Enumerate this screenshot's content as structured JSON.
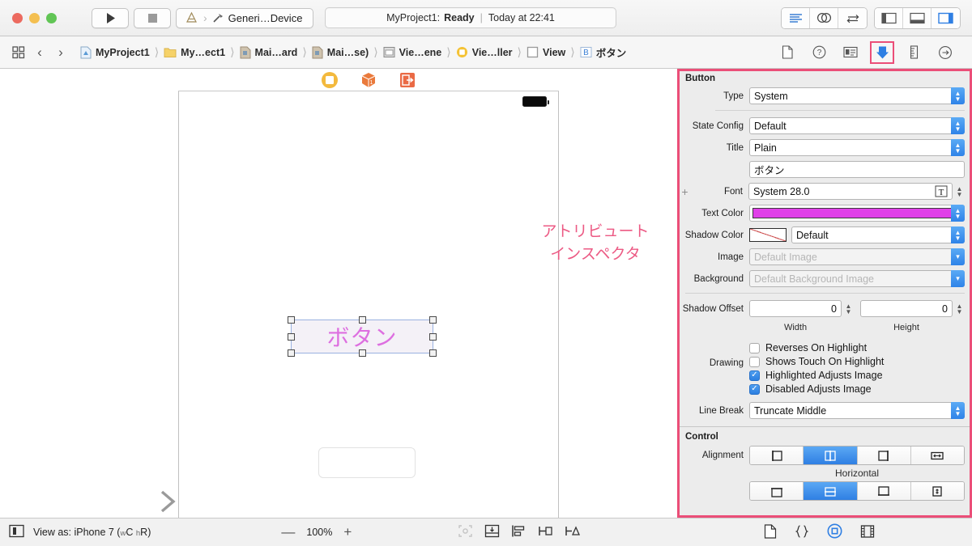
{
  "window": {
    "traffic_lights": [
      "close",
      "minimize",
      "zoom"
    ]
  },
  "toolbar": {
    "run_label": "Run",
    "stop_label": "Stop",
    "scheme_label": "Generi…Device",
    "status_project": "MyProject1:",
    "status_state": "Ready",
    "status_separator": "|",
    "status_time": "Today at 22:41",
    "editor_segments": [
      "standard-editor",
      "assistant-editor",
      "version-editor"
    ],
    "view_segments": [
      "navigator-toggle",
      "debug-area-toggle",
      "utilities-toggle"
    ]
  },
  "jumpbar": {
    "back_label": "‹",
    "forward_label": "›",
    "crumbs": [
      {
        "icon": "project-icon",
        "label": "MyProject1"
      },
      {
        "icon": "folder-icon",
        "label": "My…ect1"
      },
      {
        "icon": "storyboard-icon",
        "label": "Mai…ard"
      },
      {
        "icon": "storyboard-icon",
        "label": "Mai…se)"
      },
      {
        "icon": "scene-icon",
        "label": "Vie…ene"
      },
      {
        "icon": "viewcontroller-icon",
        "label": "Vie…ller"
      },
      {
        "icon": "view-icon",
        "label": "View"
      },
      {
        "icon": "button-icon",
        "label": "ボタン"
      }
    ],
    "inspector_tabs": [
      {
        "name": "file-inspector",
        "selected": false
      },
      {
        "name": "quick-help-inspector",
        "selected": false
      },
      {
        "name": "identity-inspector",
        "selected": false
      },
      {
        "name": "attributes-inspector",
        "selected": true
      },
      {
        "name": "size-inspector",
        "selected": false
      },
      {
        "name": "connections-inspector",
        "selected": false
      }
    ]
  },
  "canvas": {
    "scene_icons": [
      "view-controller-icon",
      "first-responder-icon",
      "exit-icon"
    ],
    "button": {
      "title": "ボタン",
      "selected": true
    },
    "textfield": {
      "placeholder": ""
    },
    "annotation_lines": [
      "アトリビュート",
      "インスペクタ"
    ],
    "annotation_color": "#ec5a84"
  },
  "inspector": {
    "sections": [
      {
        "title": "Button",
        "rows": [
          {
            "label": "Type",
            "value": "System",
            "control": "popup"
          },
          {
            "label": "State Config",
            "value": "Default",
            "control": "popup"
          },
          {
            "label": "Title",
            "value": "Plain",
            "control": "popup"
          },
          {
            "label": "",
            "value": "ボタン",
            "control": "text"
          },
          {
            "label": "Font",
            "value": "System 28.0",
            "control": "font"
          },
          {
            "label": "Text Color",
            "value": "#e040e8",
            "control": "color"
          },
          {
            "label": "Shadow Color",
            "value": "Default",
            "control": "color-popup"
          },
          {
            "label": "Image",
            "value": "Default Image",
            "control": "combo-placeholder"
          },
          {
            "label": "Background",
            "value": "Default Background Image",
            "control": "combo-placeholder"
          }
        ],
        "shadow_offset": {
          "label": "Shadow Offset",
          "width_value": "0",
          "height_value": "0",
          "width_caption": "Width",
          "height_caption": "Height"
        },
        "drawing": {
          "label": "Drawing",
          "items": [
            {
              "text": "Reverses On Highlight",
              "checked": false
            },
            {
              "text": "Shows Touch On Highlight",
              "checked": false
            },
            {
              "text": "Highlighted Adjusts Image",
              "checked": true
            },
            {
              "text": "Disabled Adjusts Image",
              "checked": true
            }
          ]
        },
        "line_break": {
          "label": "Line Break",
          "value": "Truncate Middle"
        }
      },
      {
        "title": "Control",
        "alignment": {
          "label": "Alignment",
          "caption": "Horizontal",
          "options": [
            "align-left",
            "align-center",
            "align-right",
            "align-fill"
          ],
          "selected_index": 1
        }
      }
    ]
  },
  "bottombar": {
    "view_as_label": "View as: iPhone 7 (",
    "view_as_size_w": "w",
    "view_as_size_c": "C",
    "view_as_size_h": "h",
    "view_as_size_r": "R)",
    "zoom_out": "—",
    "zoom_value": "100%",
    "zoom_in": "+",
    "align_icons": [
      "update-frames-icon",
      "embed-in-icon",
      "align-icon",
      "pin-icon",
      "resolve-issues-icon"
    ],
    "doc_icons": [
      "document-outline-icon",
      "code-icon",
      "target-icon",
      "library-icon"
    ]
  }
}
